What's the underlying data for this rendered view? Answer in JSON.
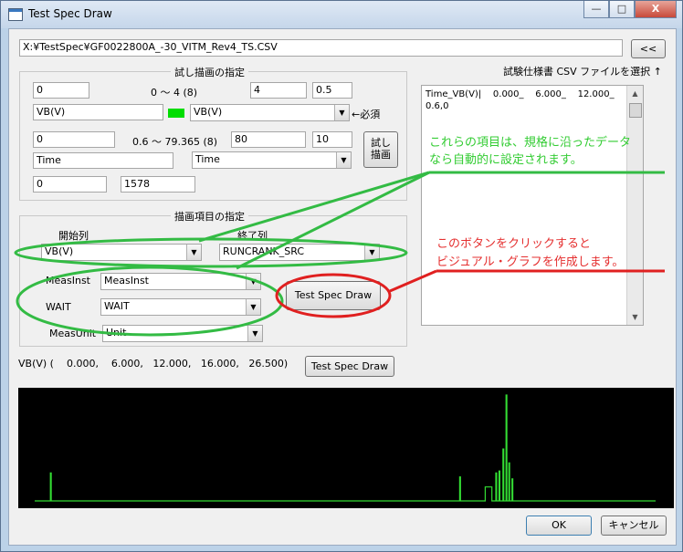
{
  "window": {
    "title": "Test Spec Draw",
    "controls": [
      "—",
      "□",
      "X"
    ]
  },
  "file": {
    "path": "X:¥TestSpec¥GF0022800A_-30_VITM_Rev4_TS.CSV",
    "back_button": "<<",
    "select_hint": "試験仕様書 CSV ファイルを選択 ↑"
  },
  "trial": {
    "group_title": "試し描画の指定",
    "row1": {
      "min": "0",
      "range": "0 ～ 4 (8)",
      "max": "4",
      "step": "0.5"
    },
    "row2": {
      "label_field": "VB(V)",
      "combo": "VB(V)",
      "required": "←必須"
    },
    "row3": {
      "min": "0",
      "range": "0.6 ～ 79.365 (8)",
      "max": "80",
      "step": "10"
    },
    "row4": {
      "label_field": "Time",
      "combo": "Time"
    },
    "row5": {
      "a": "0",
      "b": "1578"
    },
    "draw_button_line1": "試し",
    "draw_button_line2": "描画",
    "color_swatch": "#00dd00"
  },
  "items": {
    "group_title": "描画項目の指定",
    "start_col_label": "開始列",
    "end_col_label": "終了列",
    "start_col": "VB(V)",
    "end_col": "RUNCRANK_SRC",
    "meas_inst_label": "MeasInst",
    "meas_inst": "MeasInst",
    "wait_label": "WAIT",
    "wait": "WAIT",
    "meas_unit_label": "MeasUnit",
    "meas_unit": "Unit"
  },
  "spec_text": {
    "line1": "Time_VB(V)|    0.000_    6.000_    12.000_",
    "line2": "0.6,0"
  },
  "annotations": {
    "green_line1": "これらの項目は、規格に沿ったデータ",
    "green_line2": "なら自動的に設定されます。",
    "red_line1": "このボタンをクリックすると",
    "red_line2": "ビジュアル・グラフを作成します。"
  },
  "buttons": {
    "test_spec_draw": "Test Spec Draw",
    "test_spec_draw_2": "Test Spec Draw",
    "ok": "OK",
    "cancel": "キャンセル"
  },
  "values_line": "VB(V) (    0.000,    6.000,   12.000,   16.000,   26.500)",
  "colors": {
    "trace": "#33dd33",
    "annotation_green": "#33bb44",
    "annotation_red": "#e02020"
  },
  "chart_data": {
    "type": "line",
    "x_unit": "Time",
    "ylim": [
      0,
      26.5
    ],
    "xlim": [
      0,
      1578
    ],
    "points": [
      [
        0,
        0
      ],
      [
        40,
        0
      ],
      [
        40,
        7
      ],
      [
        42,
        7
      ],
      [
        42,
        0
      ],
      [
        1080,
        0
      ],
      [
        1080,
        6
      ],
      [
        1082,
        6
      ],
      [
        1082,
        0
      ],
      [
        1145,
        0
      ],
      [
        1145,
        3.5
      ],
      [
        1162,
        3.5
      ],
      [
        1162,
        0
      ],
      [
        1172,
        0
      ],
      [
        1172,
        7
      ],
      [
        1174,
        7
      ],
      [
        1174,
        0
      ],
      [
        1180,
        0
      ],
      [
        1180,
        7.5
      ],
      [
        1182,
        7.5
      ],
      [
        1182,
        0
      ],
      [
        1190,
        0
      ],
      [
        1190,
        13
      ],
      [
        1192,
        13
      ],
      [
        1192,
        0
      ],
      [
        1198,
        0
      ],
      [
        1198,
        26.5
      ],
      [
        1200,
        26.5
      ],
      [
        1200,
        0
      ],
      [
        1205,
        0
      ],
      [
        1205,
        9.5
      ],
      [
        1207,
        9.5
      ],
      [
        1207,
        0
      ],
      [
        1213,
        0
      ],
      [
        1213,
        5.5
      ],
      [
        1215,
        5.5
      ],
      [
        1215,
        0
      ],
      [
        1578,
        0
      ]
    ]
  }
}
